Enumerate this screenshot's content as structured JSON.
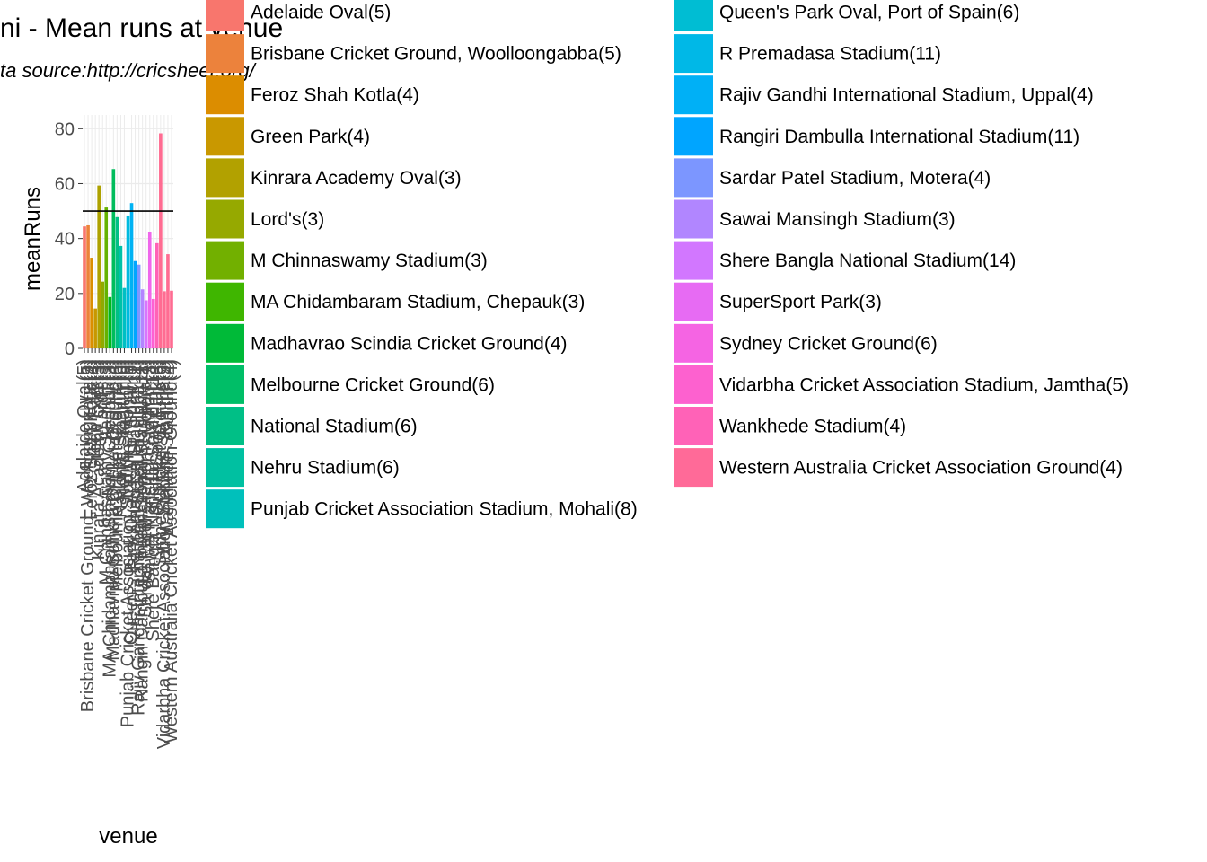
{
  "chart_data": {
    "type": "bar",
    "title": "ni - Mean runs at venue",
    "subtitle": "ta source:http://cricsheet.org/",
    "xlabel": "venue",
    "ylabel": "meanRuns",
    "ylim": [
      0,
      85
    ],
    "yticks": [
      0,
      20,
      40,
      60,
      80
    ],
    "grid": true,
    "legend_position": "right",
    "hline": 50,
    "categories": [
      "Adelaide Oval(5)",
      "Brisbane Cricket Ground, Woolloongabba(5)",
      "Feroz Shah Kotla(4)",
      "Green Park(4)",
      "Kinrara Academy Oval(3)",
      "Lord's(3)",
      "M Chinnaswamy Stadium(3)",
      "MA Chidambaram Stadium, Chepauk(3)",
      "Madhavrao Scindia Cricket Ground(4)",
      "Melbourne Cricket Ground(6)",
      "National Stadium(6)",
      "Nehru Stadium(6)",
      "Punjab Cricket Association Stadium, Mohali(8)",
      "Queen's Park Oval, Port of Spain(6)",
      "R Premadasa Stadium(11)",
      "Rajiv Gandhi International Stadium, Uppal(4)",
      "Rangiri Dambulla International Stadium(11)",
      "Sardar Patel Stadium, Motera(4)",
      "Sawai Mansingh Stadium(3)",
      "Shere Bangla National Stadium(14)",
      "SuperSport Park(3)",
      "Sydney Cricket Ground(6)",
      "Vidarbha Cricket Association Stadium, Jamtha(5)",
      "Wankhede Stadium(4)",
      "Western Australia Cricket Association Ground(4)"
    ],
    "values": [
      44.4,
      44.8,
      33.0,
      14.5,
      59.3,
      24.3,
      51.3,
      18.7,
      65.3,
      47.8,
      37.3,
      22.0,
      48.4,
      52.9,
      31.8,
      30.5,
      21.5,
      17.5,
      42.5,
      18.0,
      38.3,
      78.3,
      20.8,
      34.3,
      21.0
    ],
    "colors": [
      "#F8766D",
      "#EC8239",
      "#DB8E00",
      "#C79800",
      "#AEA200",
      "#8FAA00",
      "#64B200",
      "#00B81B",
      "#00BD5C",
      "#00C085",
      "#00C1A7",
      "#00BFC4",
      "#00BADF",
      "#00B2F3",
      "#00A6FF",
      "#7F96FF",
      "#B385FF",
      "#D874FD",
      "#EF67EB",
      "#FD61D3",
      "#FF63B6",
      "#FF6C92",
      "#FF6C92",
      "#FF6C92",
      "#FF6C92"
    ],
    "legend_colors": [
      "#F8766D",
      "#EC823C",
      "#DC8D00",
      "#C99800",
      "#B2A100",
      "#96A900",
      "#72B000",
      "#3FB600",
      "#00BA38",
      "#00BE67",
      "#00BF86",
      "#00C0A1",
      "#00C0BB",
      "#00BDD3",
      "#00B8E7",
      "#00B0F6",
      "#00A5FF",
      "#7C96FF",
      "#B186FF",
      "#D277FF",
      "#E76BF3",
      "#F564E3",
      "#FD61CF",
      "#FF62B7",
      "#FF6A98"
    ]
  }
}
